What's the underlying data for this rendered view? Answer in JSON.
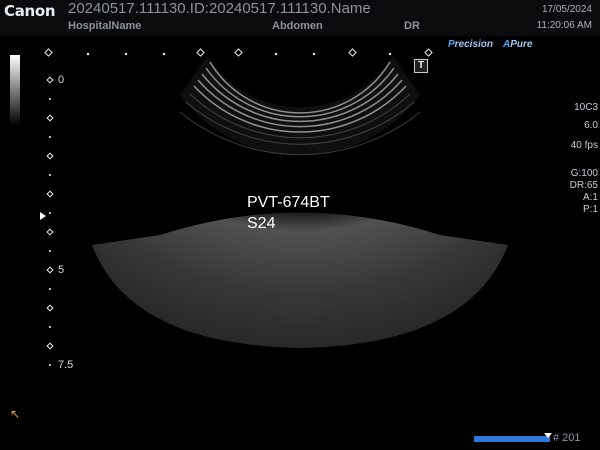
{
  "header": {
    "brand": "Canon",
    "patient_line": "20240517.111130.ID:20240517.111130.Name",
    "hospital": "HospitalName",
    "exam": "Abdomen",
    "operator": "DR",
    "date": "17/05/2024",
    "time": "11:20:06 AM"
  },
  "modes": {
    "precision": {
      "initial": "P",
      "rest": "recision"
    },
    "apure": {
      "initial": "A",
      "rest": "Pure"
    }
  },
  "params": {
    "probe": "10C3",
    "depth_cm": "6.0",
    "frame_rate": "40 fps",
    "gain": "G:100",
    "dynamic_range": "DR:65",
    "a": "A:1",
    "p": "P:1"
  },
  "annotation": {
    "line1": "PVT-674BT",
    "line2": "S24"
  },
  "t_marker": "T",
  "depth_scale": {
    "d0": "0",
    "d5": "5",
    "d75": "7.5"
  },
  "frame": {
    "number": "# 201",
    "progress": 0.95
  },
  "colors": {
    "accent": "#2f7ad8",
    "mode": "#4fa8ff",
    "cursor": "#f0a030"
  }
}
